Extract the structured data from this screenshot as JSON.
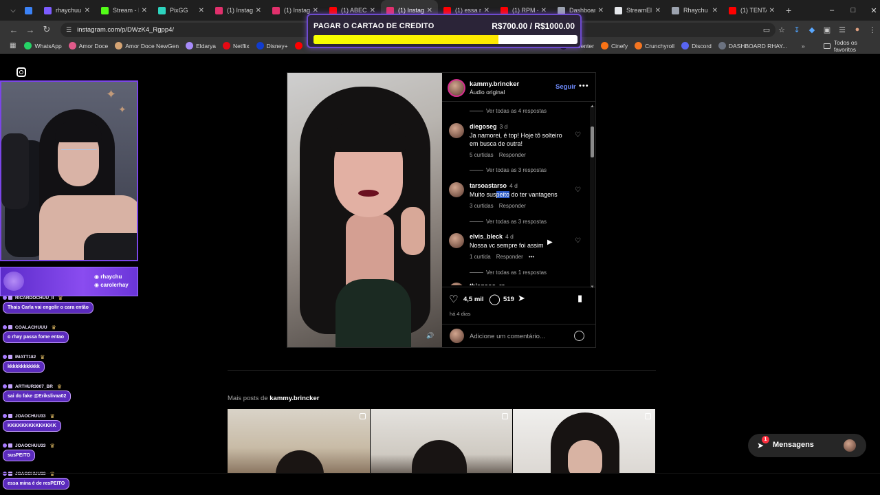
{
  "browser": {
    "tabs": [
      {
        "label": "",
        "color": "#3b82f6"
      },
      {
        "label": "rhaychuu",
        "color": "#7c5cff"
      },
      {
        "label": "Stream - I",
        "color": "#53fc18"
      },
      {
        "label": "PixGG",
        "color": "#2dd4bf"
      },
      {
        "label": "(1) Instag",
        "color": "#e1306c"
      },
      {
        "label": "(1) Instag",
        "color": "#e1306c"
      },
      {
        "label": "(1) ABECE",
        "color": "#ff0000"
      },
      {
        "label": "(1) Instag",
        "color": "#e1306c",
        "active": true
      },
      {
        "label": "(1) essa m",
        "color": "#ff0000"
      },
      {
        "label": "(1) RPM -",
        "color": "#ff0000"
      },
      {
        "label": "Dashboar",
        "color": "#9ca3af"
      },
      {
        "label": "StreamEl",
        "color": "#e5e7eb"
      },
      {
        "label": "Rhaychu",
        "color": "#9ca3af"
      },
      {
        "label": "(1) TENTA",
        "color": "#ff0000"
      }
    ],
    "url": "instagram.com/p/DWzK4_Rgpp4/",
    "bookmarks": [
      {
        "label": "WhatsApp",
        "color": "#25d366"
      },
      {
        "label": "Amor Doce",
        "color": "#e05a8a"
      },
      {
        "label": "Amor Doce NewGen",
        "color": "#d4a373"
      },
      {
        "label": "Eldarya",
        "color": "#a78bfa"
      },
      {
        "label": "Netflix",
        "color": "#e50914"
      },
      {
        "label": "Disney+",
        "color": "#113ccf"
      },
      {
        "label": "",
        "color": "#ff0000"
      },
      {
        "label": "or Center",
        "color": "#000000"
      },
      {
        "label": "Cinefy",
        "color": "#f97316"
      },
      {
        "label": "Crunchyroll",
        "color": "#f47521"
      },
      {
        "label": "Discord",
        "color": "#5865f2"
      },
      {
        "label": "DASHBOARD RHAY...",
        "color": "#6b7280"
      }
    ],
    "all_favorites": "Todos os favoritos"
  },
  "goal": {
    "title": "PAGAR O CARTAO DE CREDITO",
    "amount": "R$700.00 / R$1000.00",
    "progress": 0.7
  },
  "post": {
    "author": "kammy.brincker",
    "audio": "Áudio original",
    "follow": "Seguir",
    "comments": [
      {
        "replies_before": "Ver todas as 4 respostas"
      },
      {
        "user": "diegoseg",
        "age": "3 d",
        "text": "Ja namorei, é top! Hoje tô solteiro em busca de outra!",
        "likes": "5 curtidas",
        "reply": "Responder",
        "replies": "Ver todas as 3 respostas"
      },
      {
        "user": "tarsoastarso",
        "age": "4 d",
        "text_pre": "Muito sus",
        "text_hl": "peito",
        "text_post": " do ter vantagens",
        "likes": "3 curtidas",
        "reply": "Responder",
        "replies": "Ver todas as 3 respostas"
      },
      {
        "user": "elvis_bleck",
        "age": "4 d",
        "text": "Nossa vc sempre foi assim",
        "likes": "1 curtida",
        "reply": "Responder",
        "replies": "Ver todas as 1 respostas"
      },
      {
        "user": "thiagooo_rs"
      }
    ],
    "like_count": "4,5 mil",
    "comment_count": "519",
    "time_ago": "há 4 dias",
    "add_comment_placeholder": "Adicione um comentário..."
  },
  "more_posts": {
    "prefix": "Mais posts de ",
    "author": "kammy.brincker"
  },
  "messages": {
    "label": "Mensagens",
    "badge": "1"
  },
  "stream": {
    "socials": [
      "rhaychu",
      "carolerhay"
    ],
    "chat": [
      {
        "user": "RICARDOCHUU_II",
        "msg": "Thais Carla vai engolir o cara então"
      },
      {
        "user": "COALACHUUU",
        "msg": "o rhay passa fome entao"
      },
      {
        "user": "IMATT182",
        "msg": "kkkkkkkkkkkk"
      },
      {
        "user": "ARTHUR3007_BR",
        "msg": "sai do fake @Erikslivaa02"
      },
      {
        "user": "JOAOCHUU33",
        "msg": "KKKKKKKKKKKKKK"
      },
      {
        "user": "JOAOCHUU33",
        "msg": "susPEITO"
      },
      {
        "user": "JOAOCHUU33",
        "msg": "essa mina é de resPEITO"
      }
    ]
  }
}
